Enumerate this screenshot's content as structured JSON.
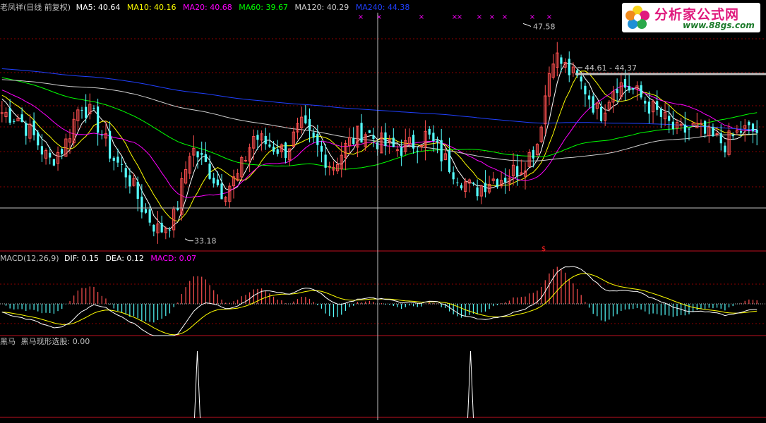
{
  "colors": {
    "bg": "#000000",
    "up": "#ff5050",
    "down": "#54ffff",
    "grid": "#8b0000",
    "ma5": "#ffffff",
    "ma10": "#ffff00",
    "ma20": "#ff00ff",
    "ma60": "#00ff00",
    "ma120": "#cfcfcf",
    "ma240": "#2040ff",
    "dif": "#ffffff",
    "dea": "#ffff00",
    "macd": "#ff00ff",
    "separator": "#c01020",
    "signal": "#ffffff",
    "header_text": "#c0c0c0",
    "star": "#ff00ff"
  },
  "price_panel": {
    "stock_title": "老凤祥(日线 前复权)",
    "ma": [
      {
        "label": "MA5:",
        "value": "40.64",
        "color": "#ffffff"
      },
      {
        "label": "MA10:",
        "value": "40.16",
        "color": "#ffff00"
      },
      {
        "label": "MA20:",
        "value": "40.68",
        "color": "#ff00ff"
      },
      {
        "label": "MA60:",
        "value": "39.67",
        "color": "#00ff00"
      },
      {
        "label": "MA120:",
        "value": "40.29",
        "color": "#cfcfcf"
      },
      {
        "label": "MA240:",
        "value": "44.38",
        "color": "#2040ff"
      }
    ],
    "high_label": "47.58",
    "low_label": "33.18",
    "range_label": "44.61 - 44.37",
    "star_glyph": "×",
    "dollar_glyph": "$"
  },
  "macd_panel": {
    "title": "MACD(12,26,9)",
    "dif": {
      "label": "DIF:",
      "value": "0.15"
    },
    "dea": {
      "label": "DEA:",
      "value": "0.12"
    },
    "macd": {
      "label": "MACD:",
      "value": "0.07"
    }
  },
  "signal_panel": {
    "title": "黑马",
    "indicator": {
      "label": "黑马现形选股:",
      "value": "0.00"
    }
  },
  "logo": {
    "title": "分析家公式网",
    "url": "www.88gs.com"
  },
  "chart_data": [
    {
      "type": "candlestick",
      "title": "老凤祥(日线 前复权)",
      "ylim": [
        32.5,
        48.5
      ],
      "price_highlights": {
        "high": 47.58,
        "low": 33.18
      },
      "ma_latest": {
        "MA5": 40.64,
        "MA10": 40.16,
        "MA20": 40.68,
        "MA60": 39.67,
        "MA120": 40.29,
        "MA240": 44.38
      },
      "close_path": [
        41.8,
        41.5,
        40.2,
        38.5,
        39.6,
        42.5,
        41.2,
        38.8,
        37.6,
        35.2,
        33.8,
        34.8,
        39.5,
        38.2,
        36.5,
        37.5,
        40.2,
        39.6,
        39.2,
        40.9,
        39.5,
        38.2,
        39.7,
        40.6,
        39.8,
        39.3,
        39.6,
        40.3,
        38.8,
        37.6,
        36.5,
        37.3,
        37.5,
        38.2,
        39.6,
        45.8,
        44.6,
        43.5,
        41.6,
        43.8,
        43.4,
        42.4,
        41.4,
        40.4,
        40.8,
        40.1,
        39.7,
        40.6,
        40.5
      ]
    },
    {
      "type": "macd",
      "title": "MACD(12,26,9)",
      "params": [
        12,
        26,
        9
      ],
      "latest": {
        "DIF": 0.15,
        "DEA": 0.12,
        "MACD": 0.07
      }
    },
    {
      "type": "signal",
      "title": "黑马现形选股",
      "latest": 0.0,
      "signal_bar_positions": [
        0.26,
        0.62
      ]
    }
  ]
}
